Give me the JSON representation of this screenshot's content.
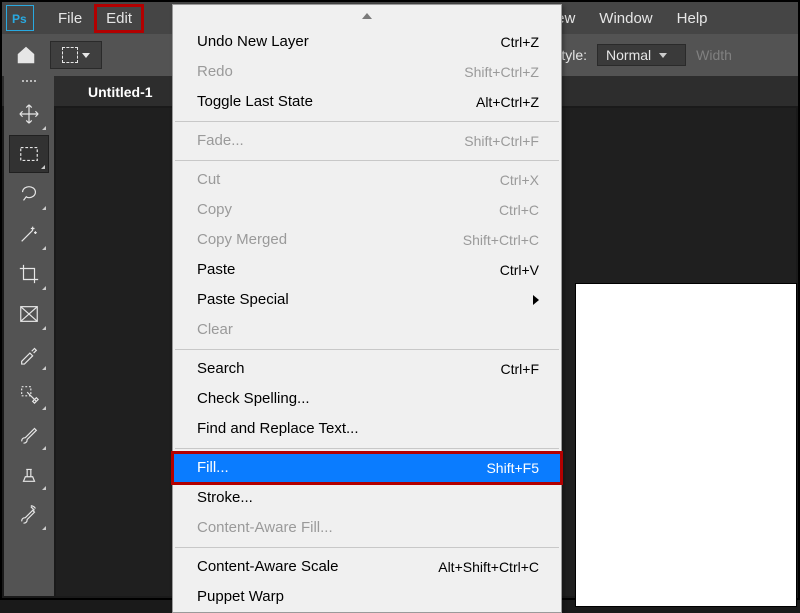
{
  "menubar": {
    "items": [
      "File",
      "Edit",
      "View",
      "Window",
      "Help"
    ],
    "highlighted_index": 1
  },
  "optionsbar": {
    "style_label": "Style:",
    "style_value": "Normal",
    "width_label": "Width"
  },
  "tabs": {
    "active": "Untitled-1"
  },
  "tools": [
    {
      "name": "move-tool"
    },
    {
      "name": "rectangular-marquee-tool",
      "selected": true
    },
    {
      "name": "lasso-tool"
    },
    {
      "name": "magic-wand-tool"
    },
    {
      "name": "crop-tool"
    },
    {
      "name": "frame-tool"
    },
    {
      "name": "eyedropper-tool"
    },
    {
      "name": "spot-healing-brush-tool"
    },
    {
      "name": "brush-tool"
    },
    {
      "name": "clone-stamp-tool"
    },
    {
      "name": "history-brush-tool"
    }
  ],
  "dropdown": {
    "groups": [
      [
        {
          "label": "Undo New Layer",
          "shortcut": "Ctrl+Z",
          "disabled": false
        },
        {
          "label": "Redo",
          "shortcut": "Shift+Ctrl+Z",
          "disabled": true
        },
        {
          "label": "Toggle Last State",
          "shortcut": "Alt+Ctrl+Z",
          "disabled": false
        }
      ],
      [
        {
          "label": "Fade...",
          "shortcut": "Shift+Ctrl+F",
          "disabled": true
        }
      ],
      [
        {
          "label": "Cut",
          "shortcut": "Ctrl+X",
          "disabled": true
        },
        {
          "label": "Copy",
          "shortcut": "Ctrl+C",
          "disabled": true
        },
        {
          "label": "Copy Merged",
          "shortcut": "Shift+Ctrl+C",
          "disabled": true
        },
        {
          "label": "Paste",
          "shortcut": "Ctrl+V",
          "disabled": false
        },
        {
          "label": "Paste Special",
          "shortcut": "",
          "disabled": false,
          "submenu": true
        },
        {
          "label": "Clear",
          "shortcut": "",
          "disabled": true
        }
      ],
      [
        {
          "label": "Search",
          "shortcut": "Ctrl+F",
          "disabled": false
        },
        {
          "label": "Check Spelling...",
          "shortcut": "",
          "disabled": false
        },
        {
          "label": "Find and Replace Text...",
          "shortcut": "",
          "disabled": false
        }
      ],
      [
        {
          "label": "Fill...",
          "shortcut": "Shift+F5",
          "disabled": false,
          "selected": true,
          "boxed": true
        },
        {
          "label": "Stroke...",
          "shortcut": "",
          "disabled": false
        },
        {
          "label": "Content-Aware Fill...",
          "shortcut": "",
          "disabled": true
        }
      ],
      [
        {
          "label": "Content-Aware Scale",
          "shortcut": "Alt+Shift+Ctrl+C",
          "disabled": false
        },
        {
          "label": "Puppet Warp",
          "shortcut": "",
          "disabled": false
        }
      ]
    ]
  }
}
